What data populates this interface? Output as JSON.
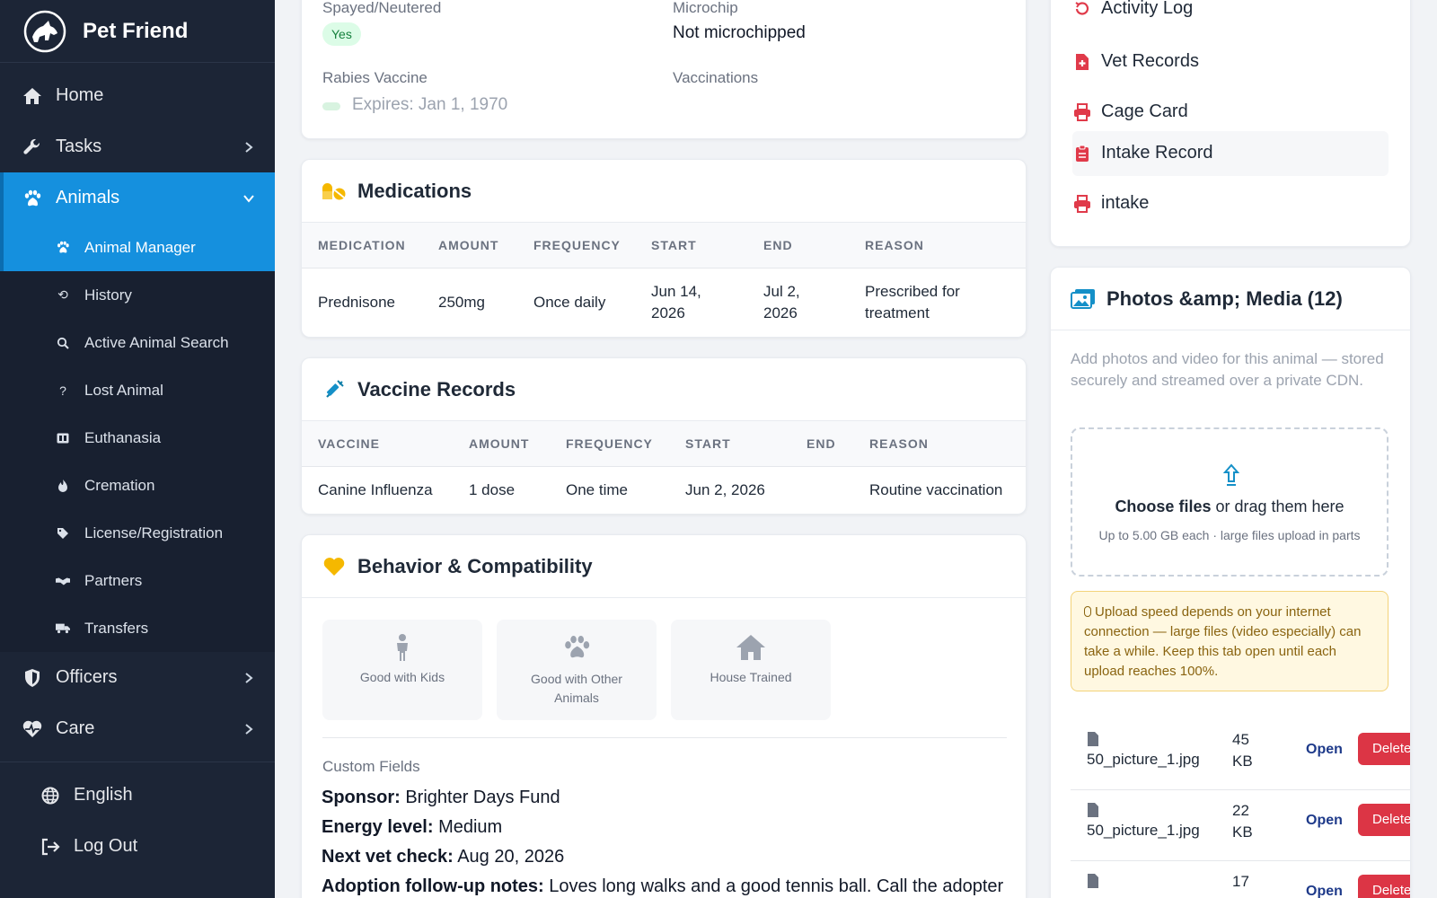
{
  "brand": {
    "name": "Pet Friend"
  },
  "nav": {
    "home": "Home",
    "tasks": "Tasks",
    "animals": "Animals",
    "officers": "Officers",
    "care": "Care",
    "english": "English",
    "logout": "Log Out"
  },
  "subnav": [
    {
      "label": "Animal Manager",
      "icon": "paw-icon",
      "glyph": "🐾"
    },
    {
      "label": "History",
      "icon": "history-icon",
      "glyph": "⟲"
    },
    {
      "label": "Active Animal Search",
      "icon": "search-icon",
      "glyph": "⚲"
    },
    {
      "label": "Lost Animal",
      "icon": "question-icon",
      "glyph": "?"
    },
    {
      "label": "Euthanasia",
      "icon": "clipboard-icon",
      "glyph": "▣"
    },
    {
      "label": "Cremation",
      "icon": "fire-icon",
      "glyph": "●"
    },
    {
      "label": "License/Registration",
      "icon": "tag-icon",
      "glyph": "◆"
    },
    {
      "label": "Partners",
      "icon": "handshake-icon",
      "glyph": "✋"
    },
    {
      "label": "Transfers",
      "icon": "truck-icon",
      "glyph": "⛟"
    }
  ],
  "info": {
    "spayed_label": "Spayed/Neutered",
    "spayed_value": "Yes",
    "microchip_label": "Microchip",
    "microchip_value": "Not microchipped",
    "rabies_label": "Rabies Vaccine",
    "rabies_value": "Expires: Jan 1, 1970",
    "vaccinations_label": "Vaccinations"
  },
  "medications": {
    "title": "Medications",
    "headers": [
      "MEDICATION",
      "AMOUNT",
      "FREQUENCY",
      "START",
      "END",
      "REASON"
    ],
    "rows": [
      {
        "name": "Prednisone",
        "amount": "250mg",
        "frequency": "Once daily",
        "start": "Jun 14, 2026",
        "end": "Jul 2, 2026",
        "reason": "Prescribed for treatment"
      }
    ]
  },
  "vaccines": {
    "title": "Vaccine Records",
    "headers": [
      "VACCINE",
      "AMOUNT",
      "FREQUENCY",
      "START",
      "END",
      "REASON"
    ],
    "rows": [
      {
        "name": "Canine Influenza",
        "amount": "1 dose",
        "frequency": "One time",
        "start": "Jun 2, 2026",
        "end": "",
        "reason": "Routine vaccination"
      }
    ]
  },
  "behavior": {
    "title": "Behavior & Compatibility",
    "tiles": [
      "Good with Kids",
      "Good with Other Animals",
      "House Trained"
    ],
    "custom_label": "Custom Fields",
    "custom": [
      {
        "key": "Sponsor:",
        "value": "Brighter Days Fund"
      },
      {
        "key": "Energy level:",
        "value": "Medium"
      },
      {
        "key": "Next vet check:",
        "value": "Aug 20, 2026"
      },
      {
        "key": "Adoption follow-up notes:",
        "value": "Loves long walks and a good tennis ball. Call the adopter"
      }
    ]
  },
  "links": {
    "activity": "Activity Log",
    "vet": "Vet Records",
    "cage": "Cage Card",
    "intake_record": "Intake Record",
    "intake": "intake"
  },
  "media": {
    "title": "Photos &amp; Media (12)",
    "description": "Add photos and video for this animal — stored securely and streamed over a private CDN.",
    "choose": "Choose files",
    "drag": " or drag them here",
    "limit": "Up to 5.00 GB each · large files upload in parts",
    "notice": "Upload speed depends on your internet connection — large files (video especially) can take a while. Keep this tab open until each upload reaches 100%.",
    "files": [
      {
        "name": "50_picture_1.jpg",
        "size_num": "45",
        "size_unit": "KB",
        "open": "Open",
        "delete": "Delete"
      },
      {
        "name": "50_picture_1.jpg",
        "size_num": "22",
        "size_unit": "KB",
        "open": "Open",
        "delete": "Delete"
      },
      {
        "name": "",
        "size_num": "17",
        "size_unit": "",
        "open": "Open",
        "delete": "Delete"
      }
    ]
  },
  "colors": {
    "sidebar_bg": "#1c2536",
    "active_blue": "#1590de",
    "danger": "#dc3545",
    "accent_red": "#e03a4a",
    "accent_yellow": "#f5b800"
  }
}
